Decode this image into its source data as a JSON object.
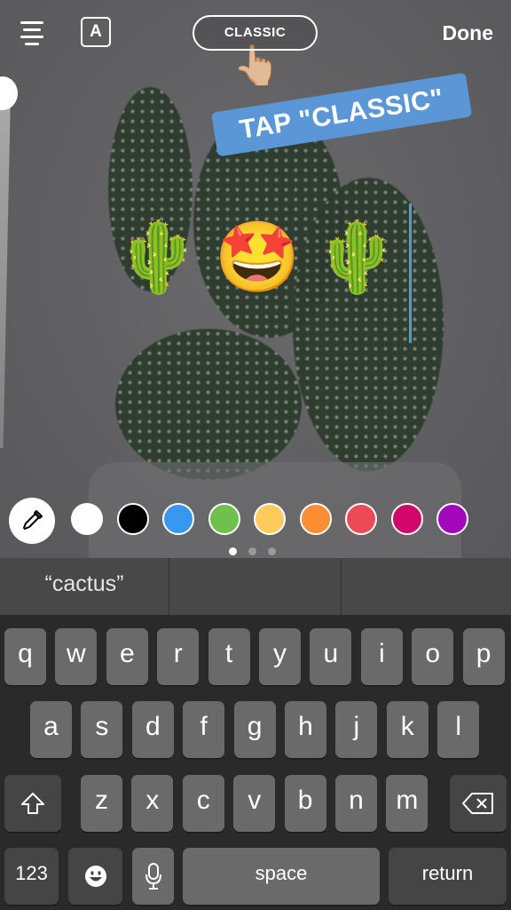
{
  "topbar": {
    "menu_icon": "text-align-icon",
    "font_toggle_label": "A",
    "style_button_label": "CLASSIC",
    "done_label": "Done"
  },
  "canvas": {
    "pointer_emoji": "👆🏼",
    "sticker_text": "TAP \"CLASSIC\"",
    "sticker_color": "#5b97d6",
    "typed_emojis": [
      "🌵",
      "🤩",
      "🌵"
    ],
    "caret_color": "#5b97d6"
  },
  "palette": {
    "eyedropper_icon": "eyedropper-icon",
    "colors": [
      {
        "name": "white",
        "hex": "#ffffff"
      },
      {
        "name": "black",
        "hex": "#000000"
      },
      {
        "name": "blue",
        "hex": "#3897f0"
      },
      {
        "name": "green",
        "hex": "#70c050"
      },
      {
        "name": "yellow",
        "hex": "#fdcb5c"
      },
      {
        "name": "orange",
        "hex": "#fd8d32"
      },
      {
        "name": "red",
        "hex": "#ed4956"
      },
      {
        "name": "magenta",
        "hex": "#d10869"
      },
      {
        "name": "purple",
        "hex": "#a307ba"
      }
    ],
    "pages": 3,
    "active_page": 1
  },
  "suggestions": [
    "“cactus”",
    "",
    ""
  ],
  "keyboard": {
    "row1": [
      "q",
      "w",
      "e",
      "r",
      "t",
      "y",
      "u",
      "i",
      "o",
      "p"
    ],
    "row2": [
      "a",
      "s",
      "d",
      "f",
      "g",
      "h",
      "j",
      "k",
      "l"
    ],
    "row3": [
      "z",
      "x",
      "c",
      "v",
      "b",
      "n",
      "m"
    ],
    "shift_icon": "shift-arrow-icon",
    "delete_icon": "backspace-icon",
    "numbers_label": "123",
    "emoji_icon": "emoji-face-icon",
    "mic_icon": "microphone-icon",
    "space_label": "space",
    "return_label": "return"
  }
}
